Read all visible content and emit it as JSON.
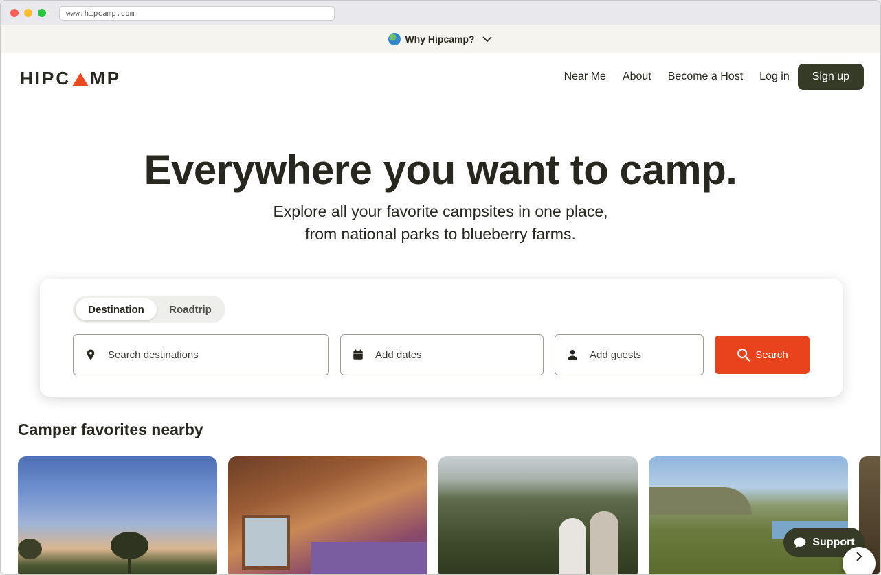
{
  "browser": {
    "url": "www.hipcamp.com"
  },
  "banner": {
    "text": "Why Hipcamp?",
    "icon": "globe-icon"
  },
  "header": {
    "logo_left": "HIPC",
    "logo_right": "MP",
    "nav": [
      {
        "label": "Near Me"
      },
      {
        "label": "About"
      },
      {
        "label": "Become a Host"
      },
      {
        "label": "Log in"
      }
    ],
    "signup_label": "Sign up"
  },
  "hero": {
    "title": "Everywhere you want to camp.",
    "subtitle_line1": "Explore all your favorite campsites in one place,",
    "subtitle_line2": "from national parks to blueberry farms."
  },
  "search": {
    "tabs": [
      {
        "label": "Destination",
        "active": true
      },
      {
        "label": "Roadtrip",
        "active": false
      }
    ],
    "destination_placeholder": "Search destinations",
    "dates_placeholder": "Add dates",
    "guests_placeholder": "Add guests",
    "button_label": "Search"
  },
  "favorites": {
    "title": "Camper favorites nearby"
  },
  "support": {
    "label": "Support"
  },
  "colors": {
    "accent": "#e8431c",
    "dark_green": "#353b27",
    "text": "#27271f"
  }
}
